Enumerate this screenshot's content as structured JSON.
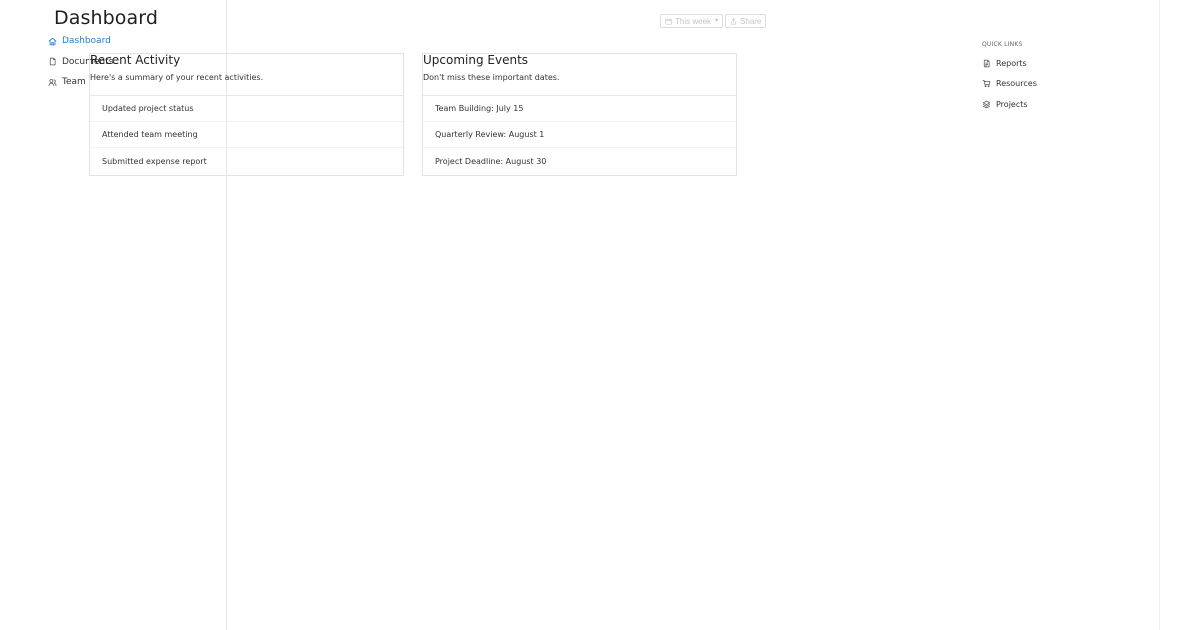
{
  "app": {
    "title": "Dashboard"
  },
  "colors": {
    "accent": "#1e7dd2",
    "text": "#222222",
    "muted": "#666666",
    "border": "#e3e3e3",
    "disabled_text": "#c4c4c4"
  },
  "sidebar": {
    "items": [
      {
        "label": "Dashboard",
        "icon": "home-icon",
        "active": true
      },
      {
        "label": "Documents",
        "icon": "document-icon",
        "active": false
      },
      {
        "label": "Team",
        "icon": "team-icon",
        "active": false
      }
    ]
  },
  "toolbar": {
    "date_range_label": "This week",
    "date_range_icon": "calendar-icon",
    "share_label": "Share",
    "share_icon": "share-icon"
  },
  "cards": {
    "recent_activity": {
      "title": "Recent Activity",
      "subtitle": "Here's a summary of your recent activities.",
      "items": [
        "Updated project status",
        "Attended team meeting",
        "Submitted expense report"
      ]
    },
    "upcoming_events": {
      "title": "Upcoming Events",
      "subtitle": "Don't miss these important dates.",
      "items": [
        "Team Building: July 15",
        "Quarterly Review: August 1",
        "Project Deadline: August 30"
      ]
    }
  },
  "quick_links": {
    "heading": "QUICK LINKS",
    "items": [
      {
        "label": "Reports",
        "icon": "report-icon"
      },
      {
        "label": "Resources",
        "icon": "cart-icon"
      },
      {
        "label": "Projects",
        "icon": "layers-icon"
      }
    ]
  }
}
